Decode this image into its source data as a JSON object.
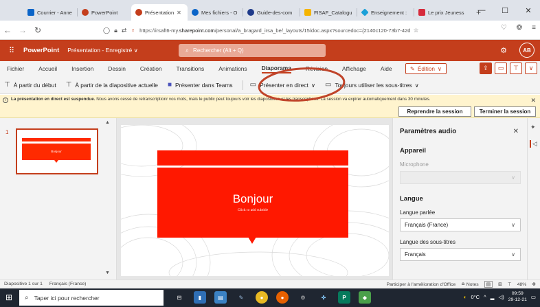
{
  "browser": {
    "tabs": [
      {
        "label": "Courrier - Anne",
        "color": "#0a64c8",
        "active": false
      },
      {
        "label": "PowerPoint",
        "color": "#c43e1c",
        "active": false
      },
      {
        "label": "Présentation",
        "color": "#c43e1c",
        "active": true
      },
      {
        "label": "Mes fichiers - O",
        "color": "#0a64c8",
        "active": false
      },
      {
        "label": "Guide-des-com",
        "color": "#1e3a8a",
        "active": false
      },
      {
        "label": "FISAF_Catalogu",
        "color": "#f5b400",
        "active": false
      },
      {
        "label": "Enseignement :",
        "color": "#1ba0d8",
        "active": false
      },
      {
        "label": "Le prix Jeuness",
        "color": "#d62b3c",
        "active": false
      }
    ],
    "url_prefix": "https://irsaft6-my.",
    "url_host": "sharepoint.com",
    "url_path": "/personal/a_bragard_irsa_be/_layouts/15/doc.aspx?sourcedoc={2140c120-73b7-42d"
  },
  "header": {
    "app_name": "PowerPoint",
    "doc_title": "Présentation - Enregistré ∨",
    "search_placeholder": "Rechercher (Alt + Q)",
    "avatar": "AB"
  },
  "ribbon": {
    "tabs": [
      "Fichier",
      "Accueil",
      "Insertion",
      "Dessin",
      "Création",
      "Transitions",
      "Animations",
      "Diaporama",
      "Révision",
      "Affichage",
      "Aide"
    ],
    "active_tab": "Diaporama",
    "edit_label": "Édition",
    "commands": {
      "from_start": "À partir du début",
      "from_current": "À partir de la diapositive actuelle",
      "teams": "Présenter dans Teams",
      "live": "Présenter en direct",
      "subtitles": "Toujours utiliser les sous-titres"
    }
  },
  "notification": {
    "bold": "La présentation en direct est suspendue.",
    "text": " Nous avons cessé de retranscriptionr vos mots, mais le public peut toujours voir les diapositives et les transcriptions. La session va expirer automatiquement dans 30 minutes.",
    "resume_label": "Reprendre la session",
    "end_label": "Terminer la session"
  },
  "thumbnails": {
    "number": "1",
    "thumb_text": "Bonjour"
  },
  "slide": {
    "title": "Bonjour",
    "subtitle": "Click to add subtitle"
  },
  "audio_panel": {
    "title": "Paramètres audio",
    "device_section": "Appareil",
    "microphone_label": "Microphone",
    "language_section": "Langue",
    "spoken_label": "Langue parlée",
    "spoken_value": "Français (France)",
    "subtitle_lang_label": "Langue des sous-titres",
    "subtitle_lang_value": "Français"
  },
  "statusbar": {
    "slide_info": "Diapositive 1 sur 1",
    "language": "Français (France)",
    "feedback": "Participer à l'amélioration d'Office",
    "notes": "Notes",
    "zoom": "48%"
  },
  "taskbar": {
    "search_placeholder": "Taper ici pour rechercher",
    "temperature": "0°C",
    "time": "09:59",
    "date": "29-12-21"
  },
  "colors": {
    "ppt_brand": "#c43e1c",
    "slide_red": "#ff1800",
    "annotation": "#c0442a"
  }
}
